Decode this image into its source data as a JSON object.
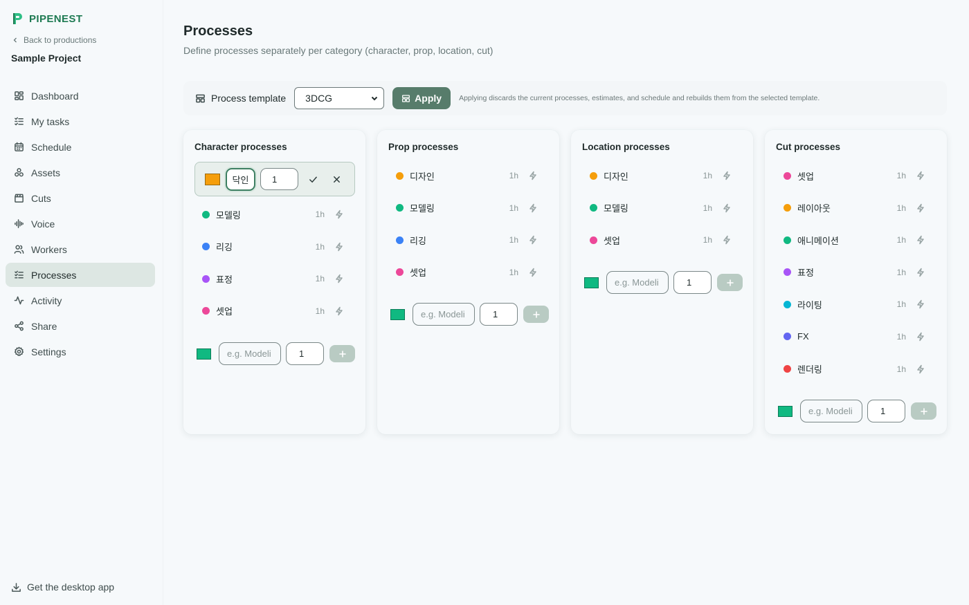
{
  "brand": {
    "name": "PIPENEST",
    "accent": "#1e7a52"
  },
  "sidebar": {
    "back_label": "Back to productions",
    "project_name": "Sample Project",
    "items": [
      {
        "label": "Dashboard",
        "icon": "dashboard-icon"
      },
      {
        "label": "My tasks",
        "icon": "checklist-icon"
      },
      {
        "label": "Schedule",
        "icon": "calendar-icon"
      },
      {
        "label": "Assets",
        "icon": "shapes-icon"
      },
      {
        "label": "Cuts",
        "icon": "clapperboard-icon"
      },
      {
        "label": "Voice",
        "icon": "audio-wave-icon"
      },
      {
        "label": "Workers",
        "icon": "users-icon"
      },
      {
        "label": "Processes",
        "icon": "list-checks-icon",
        "active": true
      },
      {
        "label": "Activity",
        "icon": "activity-icon"
      },
      {
        "label": "Share",
        "icon": "share-icon"
      },
      {
        "label": "Settings",
        "icon": "gear-icon"
      }
    ],
    "desktop_app_label": "Get the desktop app"
  },
  "header": {
    "title": "Processes",
    "subtitle": "Define processes separately per category (character, prop, location, cut)"
  },
  "template": {
    "label": "Process template",
    "selected": "3DCG",
    "apply_label": "Apply",
    "note": "Applying discards the current processes, estimates, and schedule and rebuilds them from the selected template."
  },
  "cards": {
    "character": {
      "title": "Character processes",
      "editing": {
        "name": "닥인",
        "hours": "1",
        "color": "#f59e0b"
      },
      "items": [
        {
          "name": "모델링",
          "hours": "1h",
          "color": "#10b981"
        },
        {
          "name": "리깅",
          "hours": "1h",
          "color": "#3b82f6"
        },
        {
          "name": "표정",
          "hours": "1h",
          "color": "#a855f7"
        },
        {
          "name": "셋업",
          "hours": "1h",
          "color": "#ec4899"
        }
      ],
      "add": {
        "placeholder": "e.g. Modeli",
        "hours": "1",
        "color": "#10b981"
      }
    },
    "prop": {
      "title": "Prop processes",
      "items": [
        {
          "name": "디자인",
          "hours": "1h",
          "color": "#f59e0b"
        },
        {
          "name": "모델링",
          "hours": "1h",
          "color": "#10b981"
        },
        {
          "name": "리깅",
          "hours": "1h",
          "color": "#3b82f6"
        },
        {
          "name": "셋업",
          "hours": "1h",
          "color": "#ec4899"
        }
      ],
      "add": {
        "placeholder": "e.g. Modeli",
        "hours": "1",
        "color": "#10b981"
      }
    },
    "location": {
      "title": "Location processes",
      "items": [
        {
          "name": "디자인",
          "hours": "1h",
          "color": "#f59e0b"
        },
        {
          "name": "모델링",
          "hours": "1h",
          "color": "#10b981"
        },
        {
          "name": "셋업",
          "hours": "1h",
          "color": "#ec4899"
        }
      ],
      "add": {
        "placeholder": "e.g. Modeli",
        "hours": "1",
        "color": "#10b981"
      }
    },
    "cut": {
      "title": "Cut processes",
      "items": [
        {
          "name": "셋업",
          "hours": "1h",
          "color": "#ec4899"
        },
        {
          "name": "레이아웃",
          "hours": "1h",
          "color": "#f59e0b"
        },
        {
          "name": "애니메이션",
          "hours": "1h",
          "color": "#10b981"
        },
        {
          "name": "표정",
          "hours": "1h",
          "color": "#a855f7"
        },
        {
          "name": "라이팅",
          "hours": "1h",
          "color": "#06b6d4"
        },
        {
          "name": "FX",
          "hours": "1h",
          "color": "#6366f1"
        },
        {
          "name": "렌더링",
          "hours": "1h",
          "color": "#ef4444"
        }
      ],
      "add": {
        "placeholder": "e.g. Modeli",
        "hours": "1",
        "color": "#10b981"
      }
    }
  }
}
